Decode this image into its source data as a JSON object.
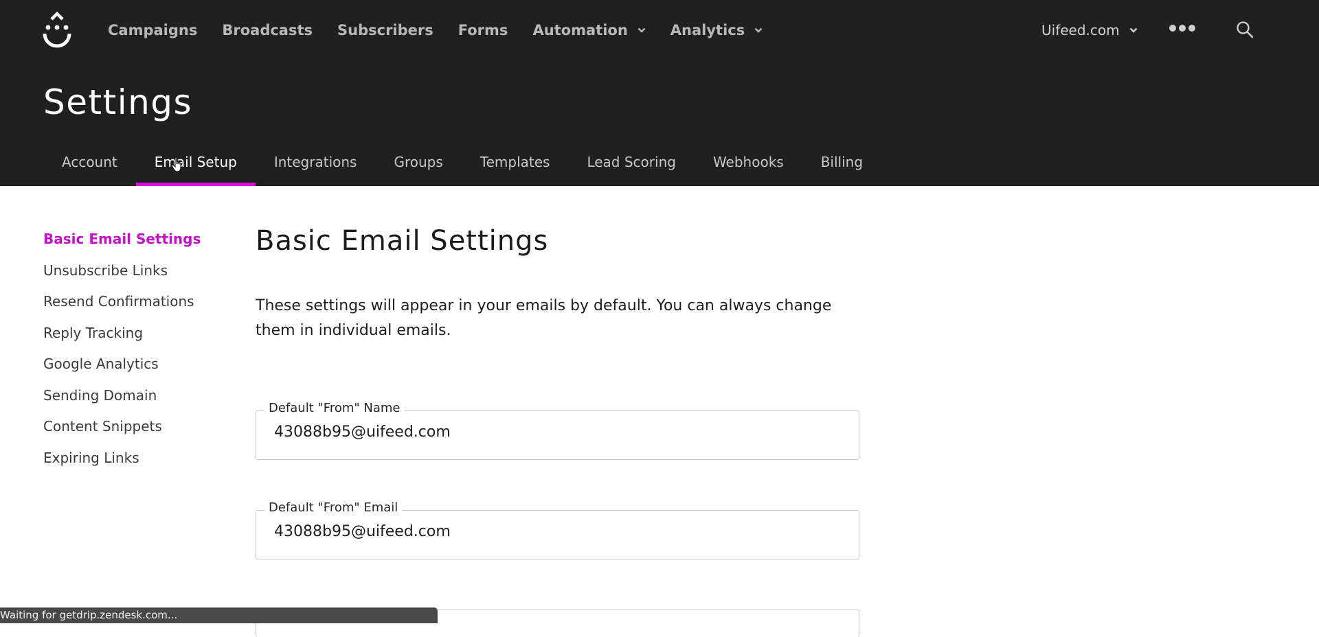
{
  "app": {
    "brand_color": "#d40fd8",
    "header_bg": "#202020",
    "logo_icon": "drip-smiley-logo"
  },
  "top_nav": {
    "items": [
      {
        "label": "Campaigns",
        "has_dropdown": false
      },
      {
        "label": "Broadcasts",
        "has_dropdown": false
      },
      {
        "label": "Subscribers",
        "has_dropdown": false
      },
      {
        "label": "Forms",
        "has_dropdown": false
      },
      {
        "label": "Automation",
        "has_dropdown": true
      },
      {
        "label": "Analytics",
        "has_dropdown": true
      }
    ],
    "account_label": "Uifeed.com",
    "more_icon": "ellipsis-icon",
    "search_icon": "search-icon"
  },
  "page": {
    "title": "Settings"
  },
  "tabs": [
    {
      "label": "Account",
      "active": false
    },
    {
      "label": "Email Setup",
      "active": true
    },
    {
      "label": "Integrations",
      "active": false
    },
    {
      "label": "Groups",
      "active": false
    },
    {
      "label": "Templates",
      "active": false
    },
    {
      "label": "Lead Scoring",
      "active": false
    },
    {
      "label": "Webhooks",
      "active": false
    },
    {
      "label": "Billing",
      "active": false
    }
  ],
  "sidebar": {
    "items": [
      {
        "label": "Basic Email Settings",
        "active": true
      },
      {
        "label": "Unsubscribe Links",
        "active": false
      },
      {
        "label": "Resend Confirmations",
        "active": false
      },
      {
        "label": "Reply Tracking",
        "active": false
      },
      {
        "label": "Google Analytics",
        "active": false
      },
      {
        "label": "Sending Domain",
        "active": false
      },
      {
        "label": "Content Snippets",
        "active": false
      },
      {
        "label": "Expiring Links",
        "active": false
      }
    ]
  },
  "main": {
    "title": "Basic Email Settings",
    "intro": "These settings will appear in your emails by default. You can always change them in individual emails.",
    "fields": [
      {
        "label": "Default \"From\" Name",
        "value": "43088b95@uifeed.com"
      },
      {
        "label": "Default \"From\" Email",
        "value": "43088b95@uifeed.com"
      }
    ]
  },
  "statusbar": {
    "text": "Waiting for getdrip.zendesk.com..."
  }
}
